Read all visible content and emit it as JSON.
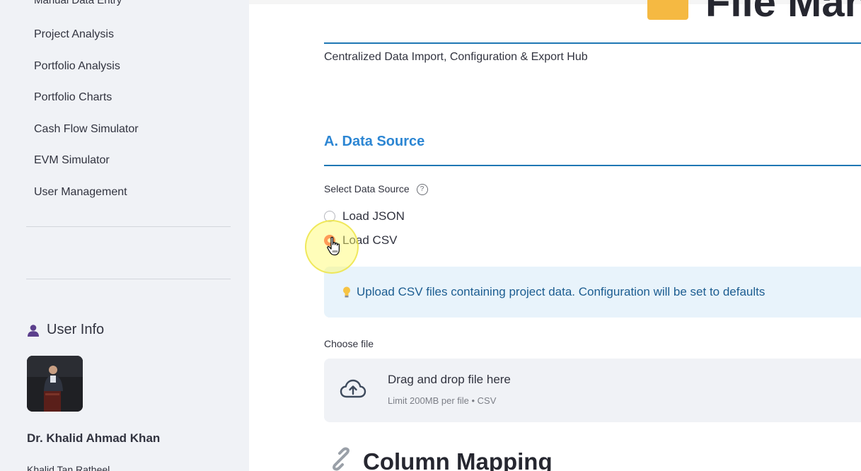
{
  "sidebar": {
    "cut_item": "Manual Data Entry",
    "items": [
      {
        "label": "Project Analysis"
      },
      {
        "label": "Portfolio Analysis"
      },
      {
        "label": "Portfolio Charts"
      },
      {
        "label": "Cash Flow Simulator"
      },
      {
        "label": "EVM Simulator"
      },
      {
        "label": "User Management"
      }
    ],
    "user_info_title": "User Info",
    "user_name": "Dr. Khalid Ahmad Khan",
    "user_subtitle": "Khalid Tan Ratheel"
  },
  "main": {
    "page_title": "File Mana",
    "subtitle": "Centralized Data Import, Configuration & Export Hub",
    "section_title": "A. Data Source",
    "select_label": "Select Data Source",
    "radio_options": [
      {
        "label": "Load JSON",
        "checked": false
      },
      {
        "label": "Load CSV",
        "checked": true
      }
    ],
    "info_text": "Upload CSV files containing project data. Configuration will be set to defaults",
    "choose_file_label": "Choose file",
    "dropzone_main": "Drag and drop file here",
    "dropzone_sub": "Limit 200MB per file • CSV",
    "column_mapping_title": "Column Mapping"
  },
  "colors": {
    "accent_red": "#ff4b4b",
    "section_blue": "#2c86d3",
    "info_bg": "#e8f3fb",
    "sidebar_bg": "#f0f2f6"
  }
}
